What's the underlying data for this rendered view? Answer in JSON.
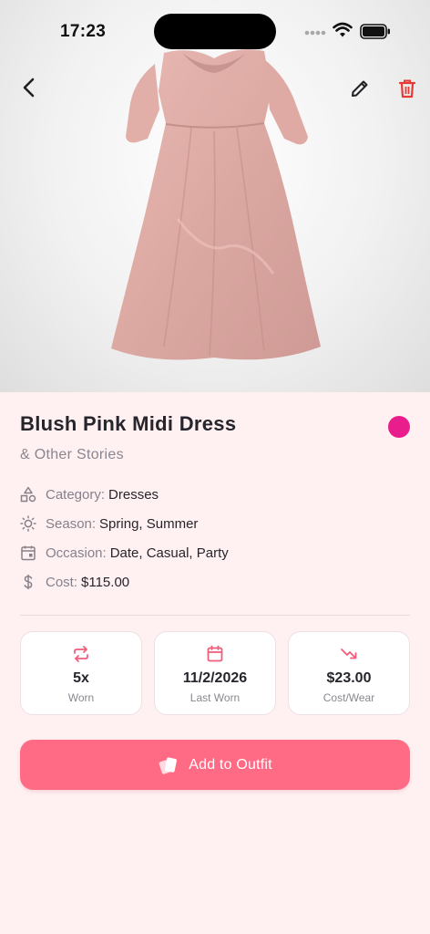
{
  "status_bar": {
    "time": "17:23"
  },
  "item": {
    "name": "Blush Pink Midi Dress",
    "brand": "& Other Stories",
    "color_hex": "#e91e8c"
  },
  "attributes": [
    {
      "icon": "category-shapes-icon",
      "label": "Category:",
      "value": "Dresses"
    },
    {
      "icon": "sun-icon",
      "label": "Season:",
      "value": "Spring, Summer"
    },
    {
      "icon": "calendar-icon",
      "label": "Occasion:",
      "value": "Date, Casual, Party"
    },
    {
      "icon": "dollar-icon",
      "label": "Cost:",
      "value": "$115.00"
    }
  ],
  "stats": [
    {
      "icon": "repeat-icon",
      "value": "5x",
      "caption": "Worn"
    },
    {
      "icon": "calendar-icon",
      "value": "11/2/2026",
      "caption": "Last Worn"
    },
    {
      "icon": "trending-down-icon",
      "value": "$23.00",
      "caption": "Cost/Wear"
    }
  ],
  "actions": {
    "add_to_outfit": "Add to Outfit"
  },
  "colors": {
    "accent": "#ff6b85",
    "background": "#fff1f2",
    "delete": "#e53935",
    "stat_icon": "#ef5f7c"
  }
}
